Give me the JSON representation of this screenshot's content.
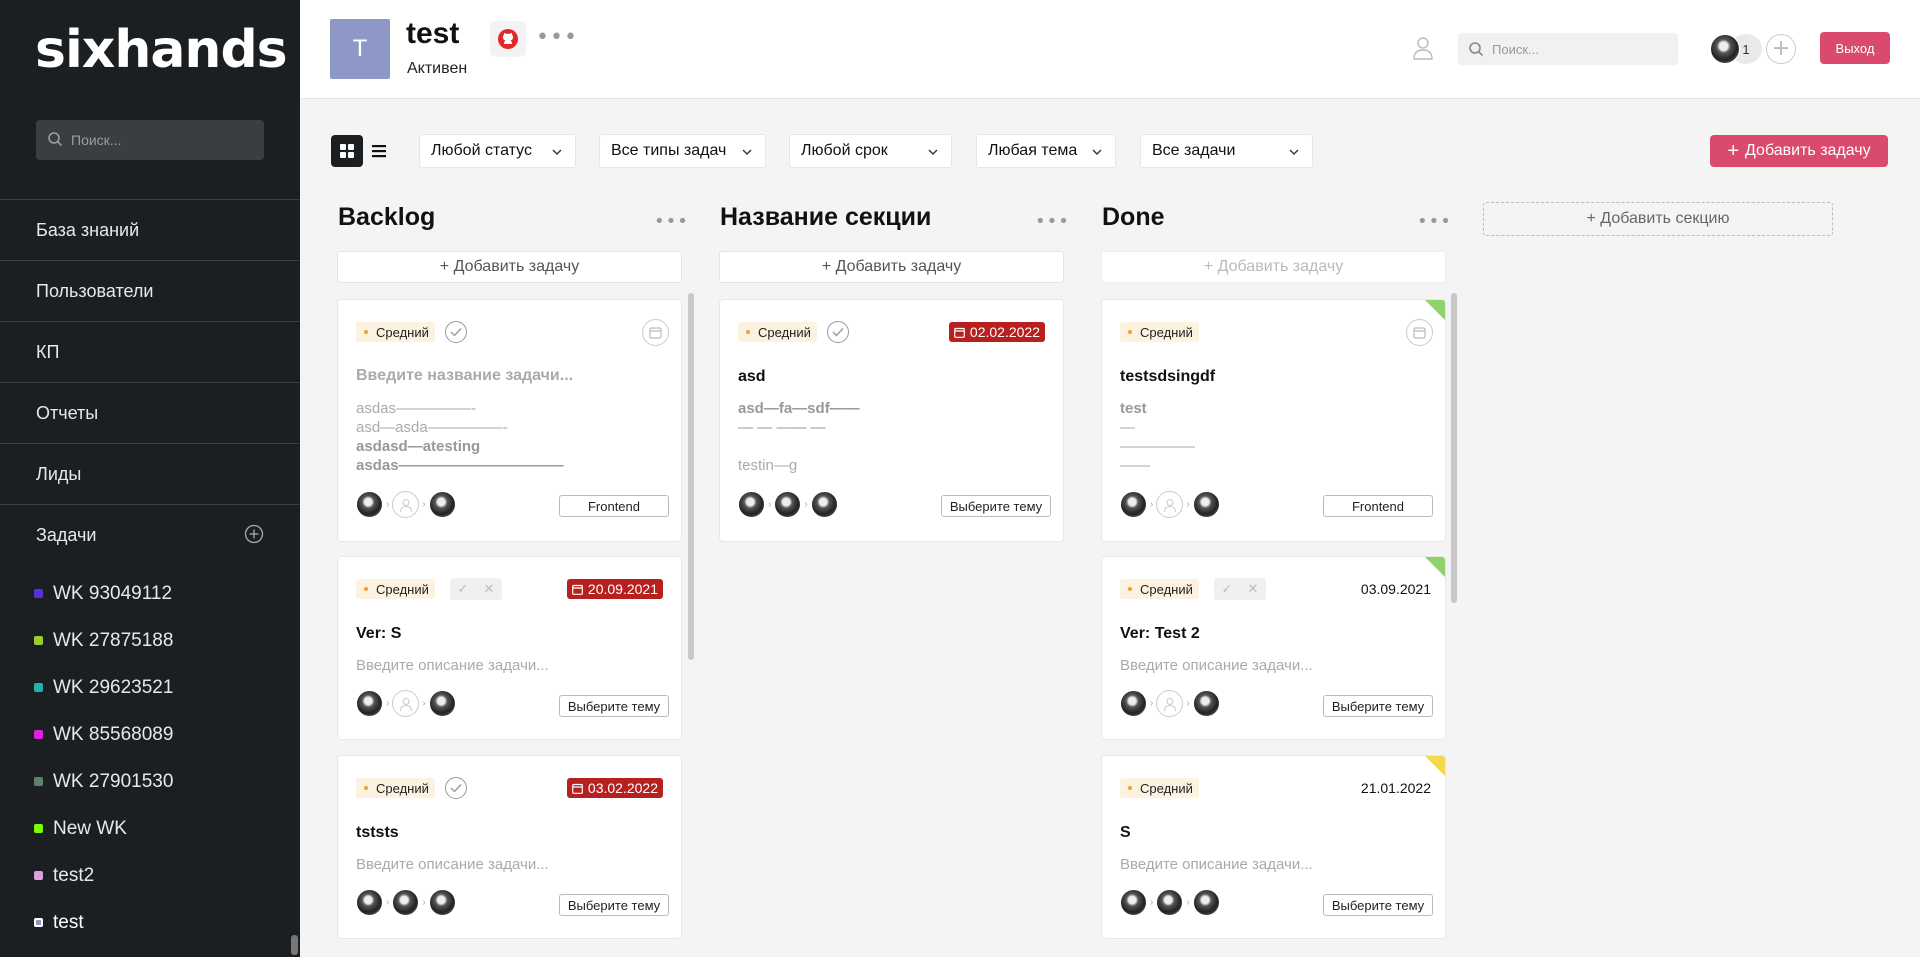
{
  "app": {
    "logo": "sixhands",
    "sidebar_search_placeholder": "Поиск...",
    "nav": [
      "База знаний",
      "Пользователи",
      "КП",
      "Отчеты",
      "Лиды",
      "Задачи"
    ],
    "projects": [
      {
        "name": "WK 93049112",
        "color": "#5b2fd6"
      },
      {
        "name": "WK 27875188",
        "color": "#9acd32"
      },
      {
        "name": "WK 29623521",
        "color": "#20b2aa"
      },
      {
        "name": "WK 85568089",
        "color": "#e020e0"
      },
      {
        "name": "WK 27901530",
        "color": "#5f7f6f"
      },
      {
        "name": "New WK",
        "color": "#7cfc00"
      },
      {
        "name": "test2",
        "color": "#dda0dd"
      },
      {
        "name": "test",
        "color": "#8d98c7"
      }
    ]
  },
  "header": {
    "avatar_letter": "T",
    "project_title": "test",
    "project_status": "Активен",
    "search_placeholder": "Поиск...",
    "member_count": "1",
    "logout_label": "Выход"
  },
  "toolbar": {
    "filters": [
      "Любой статус",
      "Все типы задач",
      "Любой срок",
      "Любая тема",
      "Все задачи"
    ],
    "add_task_label": "Добавить задачу"
  },
  "board": {
    "add_task_label": "+ Добавить задачу",
    "add_section_label": "+ Добавить секцию",
    "columns": [
      {
        "title": "Backlog",
        "cards": [
          {
            "priority": "Средний",
            "title": "Введите название задачи...",
            "desc": [
              "asdas—————-",
              "asd—asda—————-",
              "asdasd—atesting",
              "asdas———————————"
            ],
            "topic": "Frontend"
          },
          {
            "priority": "Средний",
            "date": "20.09.2021",
            "title": "Ver: S",
            "desc": [
              "Введите описание задачи..."
            ],
            "topic": "Выберите тему"
          },
          {
            "priority": "Средний",
            "date": "03.02.2022",
            "title": "tststs",
            "desc": [
              "Введите описание задачи..."
            ],
            "topic": "Выберите тему"
          }
        ]
      },
      {
        "title": "Название секции",
        "cards": [
          {
            "priority": "Средний",
            "date": "02.02.2022",
            "title": "asd",
            "desc": [
              "asd—fa—sdf——",
              "— — —— —",
              "",
              "testin—g"
            ],
            "topic": "Выберите тему"
          }
        ]
      },
      {
        "title": "Done",
        "cards": [
          {
            "priority": "Средний",
            "title": "testsdsingdf",
            "desc": [
              "test",
              "—",
              "—————",
              "——"
            ],
            "topic": "Frontend",
            "corner": "#8fd16a"
          },
          {
            "priority": "Средний",
            "date": "03.09.2021",
            "title": "Ver: Test 2",
            "desc": [
              "Введите описание задачи..."
            ],
            "topic": "Выберите тему",
            "corner": "#8fd16a"
          },
          {
            "priority": "Средний",
            "date": "21.01.2022",
            "title": "S",
            "desc": [
              "Введите описание задачи..."
            ],
            "topic": "Выберите тему",
            "corner": "#f5d94a"
          }
        ]
      }
    ]
  },
  "colors": {
    "accent": "#d94a6c",
    "overdue": "#b82020",
    "sidebar_bg": "#1c1f22"
  }
}
